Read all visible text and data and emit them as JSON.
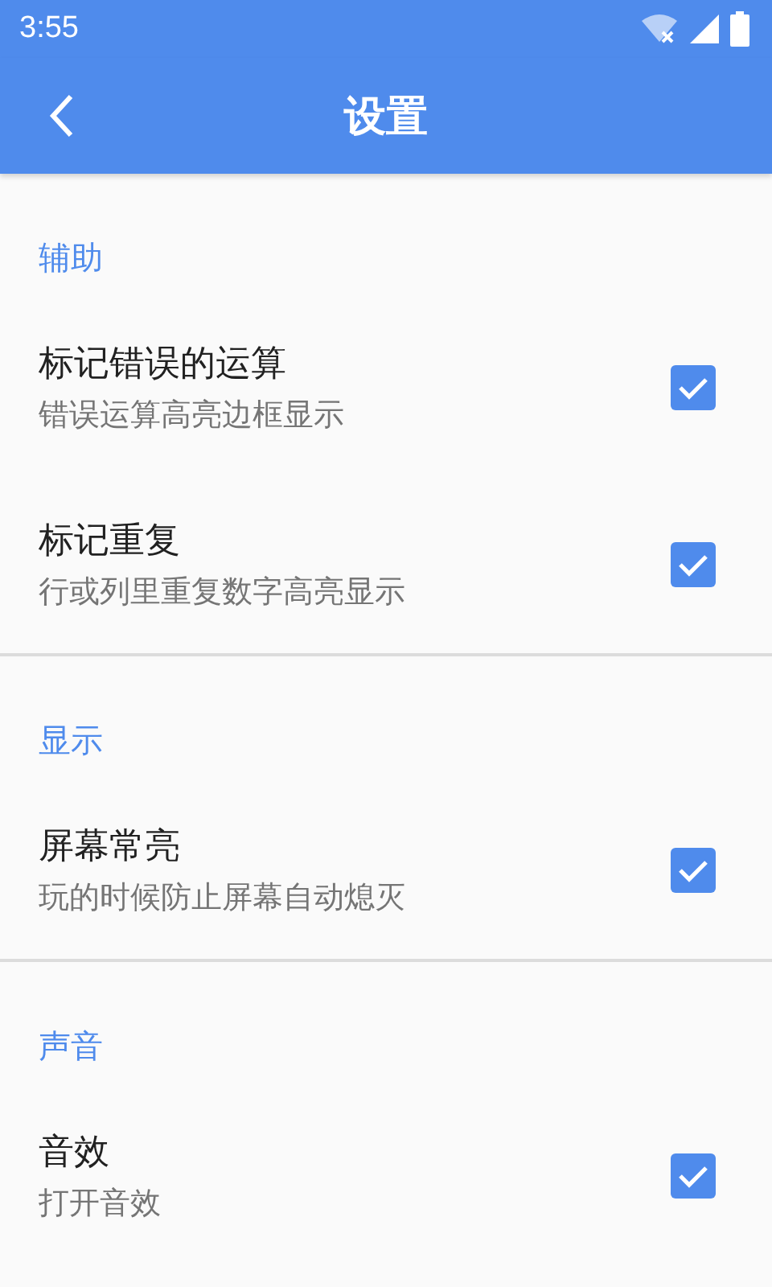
{
  "status_bar": {
    "time": "3:55"
  },
  "app_bar": {
    "title": "设置"
  },
  "sections": [
    {
      "header": "辅助",
      "items": [
        {
          "title": "标记错误的运算",
          "subtitle": "错误运算高亮边框显示",
          "checked": true
        },
        {
          "title": "标记重复",
          "subtitle": "行或列里重复数字高亮显示",
          "checked": true
        }
      ]
    },
    {
      "header": "显示",
      "items": [
        {
          "title": "屏幕常亮",
          "subtitle": "玩的时候防止屏幕自动熄灭",
          "checked": true
        }
      ]
    },
    {
      "header": "声音",
      "items": [
        {
          "title": "音效",
          "subtitle": "打开音效",
          "checked": true
        }
      ]
    }
  ]
}
